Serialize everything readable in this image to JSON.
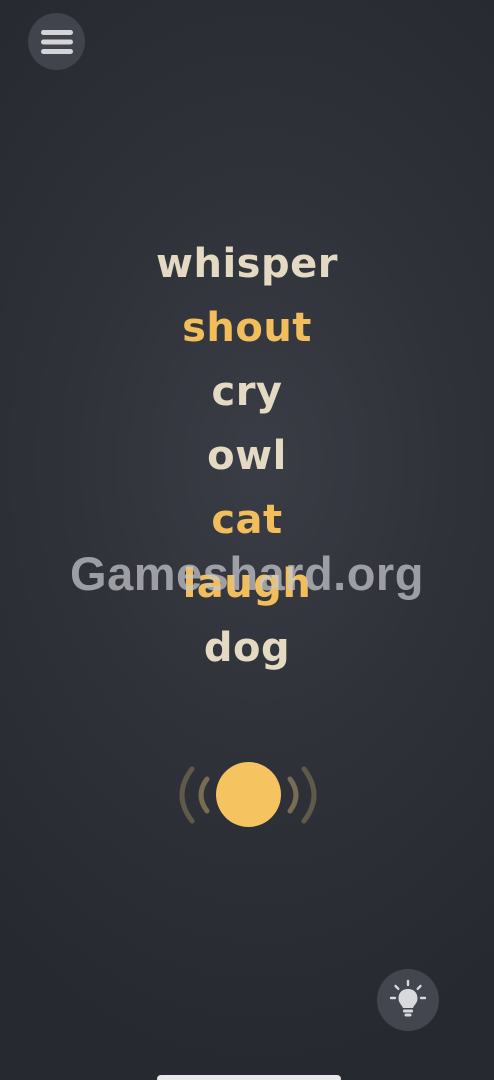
{
  "menu": {
    "icon": "hamburger-menu-icon"
  },
  "words": [
    {
      "text": "whisper",
      "highlighted": false
    },
    {
      "text": "shout",
      "highlighted": true
    },
    {
      "text": "cry",
      "highlighted": false
    },
    {
      "text": "owl",
      "highlighted": false
    },
    {
      "text": "cat",
      "highlighted": true
    },
    {
      "text": "laugh",
      "highlighted": true
    },
    {
      "text": "dog",
      "highlighted": false
    }
  ],
  "play": {
    "icon": "sound-wave-icon"
  },
  "hint": {
    "icon": "lightbulb-icon"
  },
  "watermark": {
    "text": "Gameshard.org"
  },
  "colors": {
    "background": "#2f3239",
    "word": "#e4d9c3",
    "highlight": "#f2be5c",
    "play_button": "#f5c35f",
    "round_button": "#42454d"
  }
}
